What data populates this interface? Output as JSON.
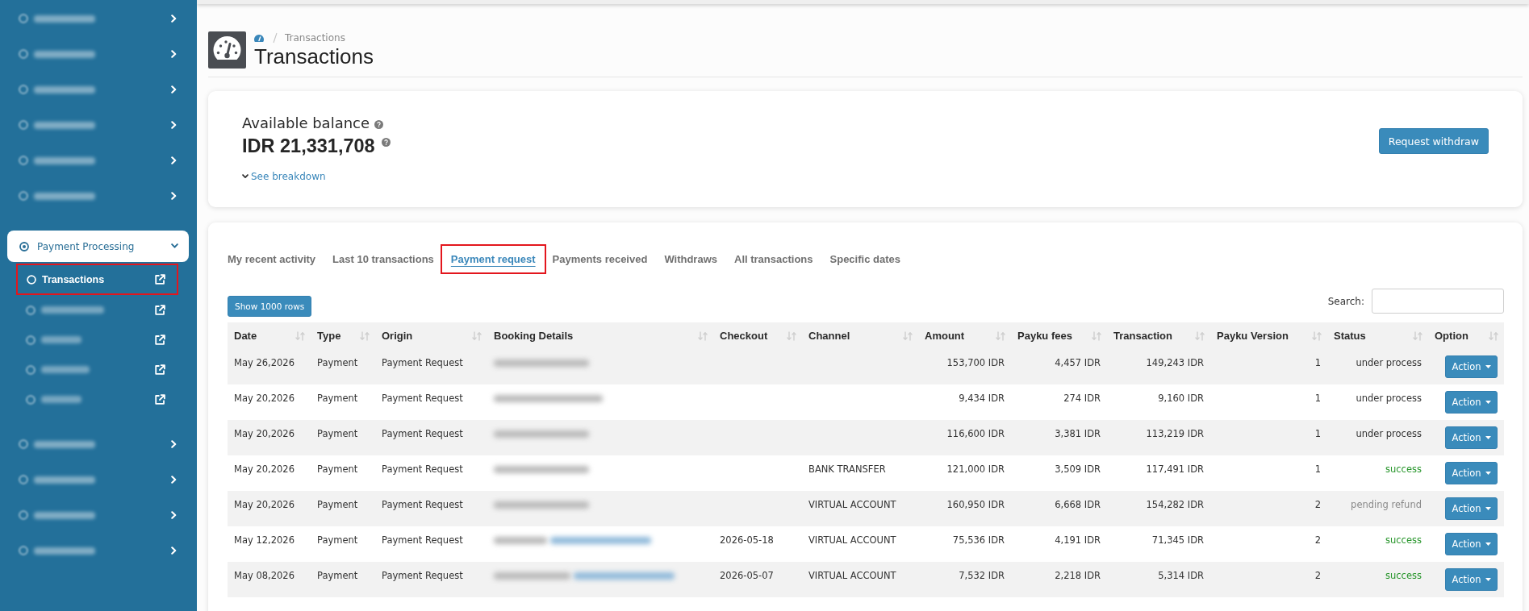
{
  "sidebar": {
    "items": [
      {
        "kind": "redacted",
        "expanded": false
      },
      {
        "kind": "redacted",
        "expanded": false
      },
      {
        "kind": "redacted",
        "expanded": false
      },
      {
        "kind": "redacted",
        "expanded": false
      },
      {
        "kind": "redacted",
        "expanded": false
      },
      {
        "kind": "redacted",
        "expanded": false
      },
      {
        "kind": "group",
        "label": "Payment Processing",
        "expanded": true,
        "children": [
          {
            "kind": "link",
            "label": "Transactions",
            "selected": true,
            "highlighted": true
          },
          {
            "kind": "redacted",
            "selected": false,
            "highlighted": false
          },
          {
            "kind": "redacted",
            "selected": false,
            "highlighted": false
          },
          {
            "kind": "redacted",
            "selected": false,
            "highlighted": false
          },
          {
            "kind": "redacted",
            "selected": false,
            "highlighted": false
          }
        ]
      },
      {
        "kind": "redacted",
        "expanded": false
      },
      {
        "kind": "redacted",
        "expanded": false
      },
      {
        "kind": "redacted",
        "expanded": false
      },
      {
        "kind": "redacted",
        "expanded": false
      }
    ]
  },
  "breadcrumb": [
    "Transactions"
  ],
  "page_title": "Transactions",
  "balance": {
    "label": "Available balance",
    "amount": "IDR 21,331,708",
    "breakdown_link": "See breakdown"
  },
  "withdraw_button": "Request withdraw",
  "tabs": [
    {
      "label": "My recent activity",
      "selected": false,
      "highlighted": false
    },
    {
      "label": "Last 10 transactions",
      "selected": false,
      "highlighted": false
    },
    {
      "label": "Payment request",
      "selected": true,
      "highlighted": true
    },
    {
      "label": "Payments received",
      "selected": false,
      "highlighted": false
    },
    {
      "label": "Withdraws",
      "selected": false,
      "highlighted": false
    },
    {
      "label": "All transactions",
      "selected": false,
      "highlighted": false
    },
    {
      "label": "Specific dates",
      "selected": false,
      "highlighted": false
    }
  ],
  "show_rows_button": "Show 1000 rows",
  "search": {
    "label": "Search:"
  },
  "table": {
    "columns": [
      "Date",
      "Type",
      "Origin",
      "Booking Details",
      "Checkout",
      "Channel",
      "Amount",
      "Payku fees",
      "Transaction",
      "Payku Version",
      "Status",
      "Option"
    ],
    "rows": [
      {
        "date": "May 26,2026",
        "type": "Payment",
        "origin": "Payment Request",
        "booking": {
          "redacted": true,
          "link": false
        },
        "amount": "153,700 IDR",
        "fees": "4,457 IDR",
        "transaction": "149,243 IDR",
        "version": "1",
        "status": {
          "text": "under process",
          "color": "#333333"
        },
        "action": "Action"
      },
      {
        "date": "May 20,2026",
        "type": "Payment",
        "origin": "Payment Request",
        "booking": {
          "redacted": true,
          "link": false
        },
        "amount": "9,434 IDR",
        "fees": "274 IDR",
        "transaction": "9,160 IDR",
        "version": "1",
        "status": {
          "text": "under process",
          "color": "#333333"
        },
        "action": "Action"
      },
      {
        "date": "May 20,2026",
        "type": "Payment",
        "origin": "Payment Request",
        "booking": {
          "redacted": true,
          "link": false
        },
        "amount": "116,600 IDR",
        "fees": "3,381 IDR",
        "transaction": "113,219 IDR",
        "version": "1",
        "status": {
          "text": "under process",
          "color": "#333333"
        },
        "action": "Action"
      },
      {
        "date": "May 20,2026",
        "type": "Payment",
        "origin": "Payment Request",
        "booking": {
          "redacted": true,
          "link": false
        },
        "channel": "BANK TRANSFER",
        "amount": "121,000 IDR",
        "fees": "3,509 IDR",
        "transaction": "117,491 IDR",
        "version": "1",
        "status": {
          "text": "success",
          "color": "#26952a"
        },
        "action": "Action"
      },
      {
        "date": "May 20,2026",
        "type": "Payment",
        "origin": "Payment Request",
        "booking": {
          "redacted": true,
          "link": false
        },
        "channel": "VIRTUAL ACCOUNT",
        "amount": "160,950 IDR",
        "fees": "6,668 IDR",
        "transaction": "154,282 IDR",
        "version": "2",
        "status": {
          "text": "pending refund",
          "color": "#8a8a8a"
        },
        "action": "Action"
      },
      {
        "date": "May 12,2026",
        "type": "Payment",
        "origin": "Payment Request",
        "booking": {
          "redacted": true,
          "link": true
        },
        "checkout": "2026-05-18",
        "channel": "VIRTUAL ACCOUNT",
        "amount": "75,536 IDR",
        "fees": "4,191 IDR",
        "transaction": "71,345 IDR",
        "version": "2",
        "status": {
          "text": "success",
          "color": "#26952a"
        },
        "action": "Action"
      },
      {
        "date": "May 08,2026",
        "type": "Payment",
        "origin": "Payment Request",
        "booking": {
          "redacted": true,
          "link": true
        },
        "checkout": "2026-05-07",
        "channel": "VIRTUAL ACCOUNT",
        "amount": "7,532 IDR",
        "fees": "2,218 IDR",
        "transaction": "5,314 IDR",
        "version": "2",
        "status": {
          "text": "success",
          "color": "#26952a"
        },
        "action": "Action"
      }
    ]
  }
}
